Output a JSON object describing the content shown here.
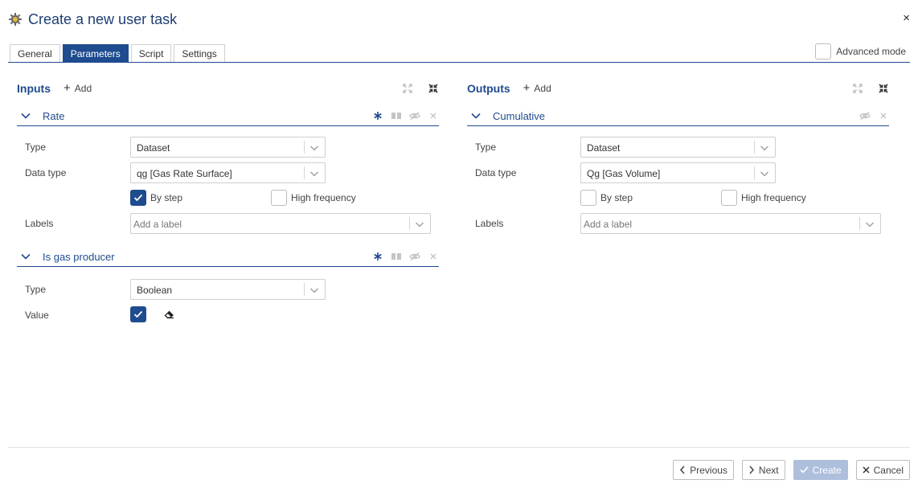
{
  "dialog": {
    "title": "Create a new user task",
    "close": "×"
  },
  "tabs": [
    {
      "label": "General",
      "active": false
    },
    {
      "label": "Parameters",
      "active": true
    },
    {
      "label": "Script",
      "active": false
    },
    {
      "label": "Settings",
      "active": false
    }
  ],
  "advanced_mode": {
    "label": "Advanced mode",
    "checked": false
  },
  "inputs": {
    "title": "Inputs",
    "add_label": "Add",
    "sections": [
      {
        "title": "Rate",
        "type_label": "Type",
        "type_value": "Dataset",
        "data_type_label": "Data type",
        "data_type_value": "qg [Gas Rate Surface]",
        "by_step_label": "By step",
        "by_step_checked": true,
        "high_freq_label": "High frequency",
        "high_freq_checked": false,
        "labels_label": "Labels",
        "labels_placeholder": "Add a label"
      },
      {
        "title": "Is gas producer",
        "type_label": "Type",
        "type_value": "Boolean",
        "value_label": "Value",
        "value_checked": true
      }
    ]
  },
  "outputs": {
    "title": "Outputs",
    "add_label": "Add",
    "sections": [
      {
        "title": "Cumulative",
        "type_label": "Type",
        "type_value": "Dataset",
        "data_type_label": "Data type",
        "data_type_value": "Qg [Gas Volume]",
        "by_step_label": "By step",
        "by_step_checked": false,
        "high_freq_label": "High frequency",
        "high_freq_checked": false,
        "labels_label": "Labels",
        "labels_placeholder": "Add a label"
      }
    ]
  },
  "footer": {
    "previous": "Previous",
    "next": "Next",
    "create": "Create",
    "cancel": "Cancel"
  },
  "colors": {
    "accent": "#1f4b8f",
    "title": "#1f3f73",
    "disabled": "#aebfdc"
  }
}
